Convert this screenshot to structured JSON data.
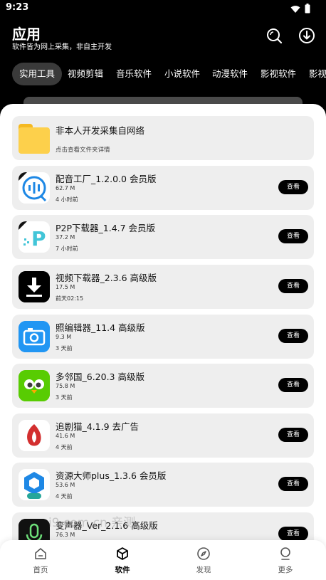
{
  "status": {
    "time": "9:23"
  },
  "header": {
    "title": "应用",
    "subtitle": "软件皆为网上采集，非自主开发"
  },
  "tabs": [
    {
      "label": "实用工具",
      "active": true
    },
    {
      "label": "视频剪辑"
    },
    {
      "label": "音乐软件"
    },
    {
      "label": "小说软件"
    },
    {
      "label": "动漫软件"
    },
    {
      "label": "影视软件"
    },
    {
      "label": "影视"
    }
  ],
  "folder": {
    "title": "非本人开发采集自网络",
    "hint": "点击查看文件夹详情"
  },
  "view_label": "查看",
  "apps": [
    {
      "name": "配音工厂_1.2.0.0 会员版",
      "size": "62.7 M",
      "time": "4 小时前",
      "icon": "dubbing-factory-icon",
      "color": "#1e88e5"
    },
    {
      "name": "P2P下载器_1.4.7 会员版",
      "size": "37.2 M",
      "time": "7 小时前",
      "icon": "p2p-downloader-icon",
      "color": "#42c5d8"
    },
    {
      "name": "视频下载器_2.3.6 高级版",
      "size": "17.5 M",
      "time": "前天02:15",
      "icon": "video-downloader-icon",
      "color": "#000000"
    },
    {
      "name": "照编辑器_11.4 高级版",
      "size": "9.3 M",
      "time": "3 天前",
      "icon": "photo-editor-icon",
      "color": "#2196f3"
    },
    {
      "name": "多邻国_6.20.3 高级版",
      "size": "75.8 M",
      "time": "3 天前",
      "icon": "duolingo-icon",
      "color": "#58cc02"
    },
    {
      "name": "追剧猫_4.1.9 去广告",
      "size": "41.6 M",
      "time": "4 天前",
      "icon": "drama-cat-icon",
      "color": "#e53935"
    },
    {
      "name": "资源大师plus_1.3.6 会员版",
      "size": "53.6 M",
      "time": "4 天前",
      "icon": "resource-master-icon",
      "color": "#1e88e5"
    },
    {
      "name": "变声器_Ver_2.1.6 高级版",
      "size": "76.3 M",
      "time": "",
      "icon": "voice-changer-icon",
      "color": "#111111"
    }
  ],
  "watermark": "i9 com.cn 亲测",
  "nav": [
    {
      "label": "首页",
      "icon": "home-icon"
    },
    {
      "label": "软件",
      "icon": "package-icon",
      "active": true
    },
    {
      "label": "发现",
      "icon": "compass-icon"
    },
    {
      "label": "更多",
      "icon": "user-icon"
    }
  ]
}
